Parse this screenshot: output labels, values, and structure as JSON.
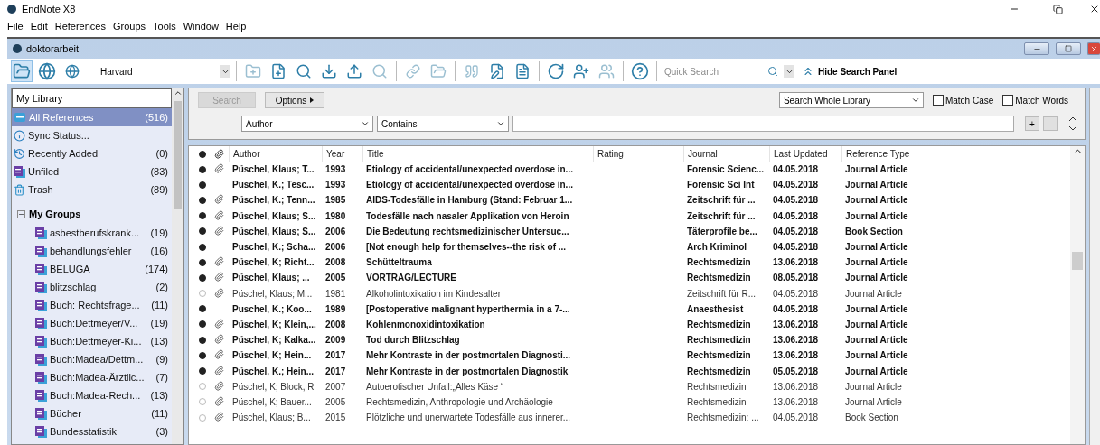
{
  "app": {
    "title": "EndNote X8"
  },
  "menu": [
    "File",
    "Edit",
    "References",
    "Groups",
    "Tools",
    "Window",
    "Help"
  ],
  "library_window": {
    "title": "doktorarbeit"
  },
  "toolbar": {
    "style": "Harvard",
    "quick_search": {
      "placeholder": "Quick Search"
    },
    "hide_search_panel": "Hide Search Panel"
  },
  "sidebar": {
    "header": "My Library",
    "items": [
      {
        "kind": "all",
        "label": "All References",
        "count": "(516)",
        "selected": true
      },
      {
        "kind": "sync",
        "label": "Sync Status...",
        "selected": false
      },
      {
        "kind": "recent",
        "label": "Recently Added",
        "count": "(0)",
        "selected": false
      },
      {
        "kind": "unfiled",
        "label": "Unfiled",
        "count": "(83)",
        "selected": false
      },
      {
        "kind": "trash",
        "label": "Trash",
        "count": "(89)",
        "selected": false
      }
    ],
    "groups_header": "My Groups",
    "groups_expanded": true,
    "groups": [
      {
        "label": "asbestberufskrank...",
        "count": "(19)"
      },
      {
        "label": "behandlungsfehler",
        "count": "(16)"
      },
      {
        "label": "BELUGA",
        "count": "(174)"
      },
      {
        "label": "blitzschlag",
        "count": "(2)"
      },
      {
        "label": "Buch: Rechtsfrage...",
        "count": "(11)"
      },
      {
        "label": "Buch:Dettmeyer/V...",
        "count": "(19)"
      },
      {
        "label": "Buch:Dettmeyer-Ki...",
        "count": "(13)"
      },
      {
        "label": "Buch:Madea/Dettm...",
        "count": "(9)"
      },
      {
        "label": "Buch:Madea-Ärztlic...",
        "count": "(7)"
      },
      {
        "label": "Buch:Madea-Rech...",
        "count": "(13)"
      },
      {
        "label": "Bücher",
        "count": "(11)"
      },
      {
        "label": "Bundesstatistik",
        "count": "(3)"
      }
    ]
  },
  "search_panel": {
    "search_button": "Search",
    "options_button": "Options",
    "scope": "Search Whole Library",
    "match_case": {
      "label": "Match Case",
      "checked": false
    },
    "match_words": {
      "label": "Match Words",
      "checked": false
    },
    "field": "Author",
    "operator": "Contains",
    "plus": "+",
    "minus": "-"
  },
  "table": {
    "columns": [
      "Author",
      "Year",
      "Title",
      "Rating",
      "Journal",
      "Last Updated",
      "Reference Type"
    ],
    "rows": [
      {
        "unread": true,
        "attachment": true,
        "author": "Püschel, Klaus; T...",
        "year": "1993",
        "title": "Etiology of accidental/unexpected overdose in...",
        "journal": "Forensic Scienc...",
        "updated": "04.05.2018",
        "type": "Journal Article"
      },
      {
        "unread": true,
        "attachment": false,
        "author": "Puschel, K.; Tesc...",
        "year": "1993",
        "title": "Etiology of accidental/unexpected overdose in...",
        "journal": "Forensic Sci Int",
        "updated": "04.05.2018",
        "type": "Journal Article"
      },
      {
        "unread": true,
        "attachment": true,
        "author": "Püschel, K.; Tenn...",
        "year": "1985",
        "title": "AIDS-Todesfälle in Hamburg (Stand: Februar 1...",
        "journal": "Zeitschrift für ...",
        "updated": "04.05.2018",
        "type": "Journal Article"
      },
      {
        "unread": true,
        "attachment": true,
        "author": "Püschel, Klaus; S...",
        "year": "1980",
        "title": "Todesfälle nach nasaler Applikation von Heroin",
        "journal": "Zeitschrift für ...",
        "updated": "04.05.2018",
        "type": "Journal Article"
      },
      {
        "unread": true,
        "attachment": true,
        "author": "Püschel, Klaus; S...",
        "year": "2006",
        "title": "Die Bedeutung rechtsmedizinischer Untersuc...",
        "journal": "Täterprofile be...",
        "updated": "04.05.2018",
        "type": "Book Section"
      },
      {
        "unread": true,
        "attachment": false,
        "author": "Puschel, K.; Scha...",
        "year": "2006",
        "title": "[Not enough help for themselves--the risk of ...",
        "journal": "Arch Kriminol",
        "updated": "04.05.2018",
        "type": "Journal Article"
      },
      {
        "unread": true,
        "attachment": true,
        "author": "Püschel, K; Richt...",
        "year": "2008",
        "title": "Schütteltrauma",
        "journal": "Rechtsmedizin",
        "updated": "13.06.2018",
        "type": "Journal Article"
      },
      {
        "unread": true,
        "attachment": true,
        "author": "Püschel, Klaus; ...",
        "year": "2005",
        "title": "VORTRAG/LECTURE",
        "journal": "Rechtsmedizin",
        "updated": "08.05.2018",
        "type": "Journal Article"
      },
      {
        "unread": false,
        "attachment": true,
        "author": "Püschel, Klaus; M...",
        "year": "1981",
        "title": "Alkoholintoxikation im Kindesalter",
        "journal": "Zeitschrift für R...",
        "updated": "04.05.2018",
        "type": "Journal Article"
      },
      {
        "unread": true,
        "attachment": false,
        "author": "Puschel, K.; Koo...",
        "year": "1989",
        "title": "[Postoperative malignant hyperthermia in a 7-...",
        "journal": "Anaesthesist",
        "updated": "04.05.2018",
        "type": "Journal Article"
      },
      {
        "unread": true,
        "attachment": true,
        "author": "Püschel, K; Klein,...",
        "year": "2008",
        "title": "Kohlenmonoxidintoxikation",
        "journal": "Rechtsmedizin",
        "updated": "13.06.2018",
        "type": "Journal Article"
      },
      {
        "unread": true,
        "attachment": true,
        "author": "Püschel, K; Kalka...",
        "year": "2009",
        "title": "Tod durch Blitzschlag",
        "journal": "Rechtsmedizin",
        "updated": "13.06.2018",
        "type": "Journal Article"
      },
      {
        "unread": true,
        "attachment": true,
        "author": "Püschel, K; Hein...",
        "year": "2017",
        "title": "Mehr Kontraste in der postmortalen Diagnosti...",
        "journal": "Rechtsmedizin",
        "updated": "13.06.2018",
        "type": "Journal Article"
      },
      {
        "unread": true,
        "attachment": true,
        "author": "Püschel, K.; Hein...",
        "year": "2017",
        "title": "Mehr Kontraste in der postmortalen Diagnostik",
        "journal": "Rechtsmedizin",
        "updated": "05.05.2018",
        "type": "Journal Article"
      },
      {
        "unread": false,
        "attachment": true,
        "author": "Püschel, K; Block, R",
        "year": "2007",
        "title": "Autoerotischer Unfall:„Alles Käse “",
        "journal": "Rechtsmedizin",
        "updated": "13.06.2018",
        "type": "Journal Article"
      },
      {
        "unread": false,
        "attachment": true,
        "author": "Püschel, K; Bauer...",
        "year": "2005",
        "title": "Rechtsmedizin, Anthropologie und Archäologie",
        "journal": "Rechtsmedizin",
        "updated": "13.06.2018",
        "type": "Journal Article"
      },
      {
        "unread": false,
        "attachment": true,
        "author": "Püschel, Klaus; B...",
        "year": "2015",
        "title": "Plötzliche und unerwartete Todesfälle aus innerer...",
        "journal": "Rechtsmedizin: ...",
        "updated": "04.05.2018",
        "type": "Book Section"
      }
    ]
  }
}
